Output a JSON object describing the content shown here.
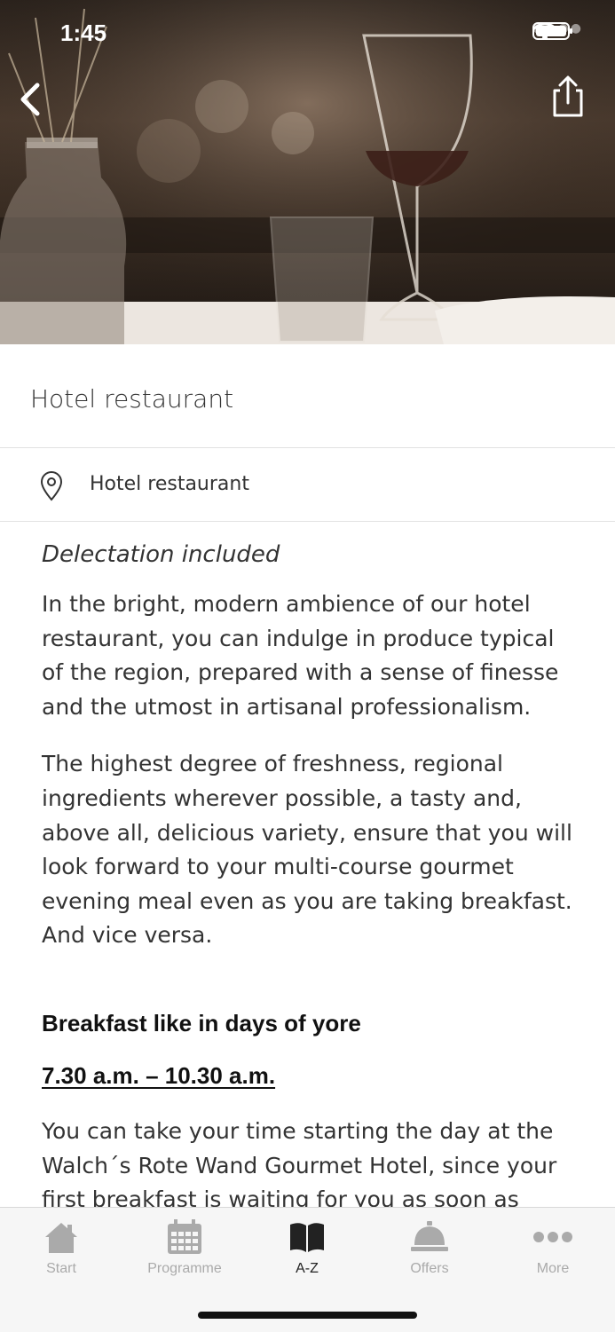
{
  "status_bar": {
    "time": "1:45"
  },
  "header": {
    "title": "Hotel restaurant"
  },
  "location": {
    "label": "Hotel restaurant"
  },
  "content": {
    "intro": "Delectation included",
    "paragraph1": "In the bright, modern ambience of our hotel restaurant, you can indulge in produce typical of the region, prepared with a sense of finesse and the utmost in artisanal professionalism.",
    "paragraph2": "The highest degree of freshness, regional ingredients wherever possible, a tasty and, above all, delicious variety, ensure that you will look forward to your multi-course gourmet evening meal even as you are taking breakfast. And vice versa.",
    "section_heading": "Breakfast like in days of yore",
    "hours": "7.30 a.m. – 10.30 a.m.",
    "paragraph3": "You can take your time starting the day at the Walch´s Rote Wand Gourmet Hotel, since your first breakfast is waiting for you as soon as table"
  },
  "tabbar": {
    "tabs": [
      {
        "label": "Start",
        "icon": "home-icon"
      },
      {
        "label": "Programme",
        "icon": "calendar-icon"
      },
      {
        "label": "A-Z",
        "icon": "book-icon",
        "active": true
      },
      {
        "label": "Offers",
        "icon": "service-bell-icon"
      },
      {
        "label": "More",
        "icon": "more-dots-icon"
      }
    ]
  },
  "colors": {
    "accent_active": "#222222",
    "inactive": "#aaaaaa"
  }
}
